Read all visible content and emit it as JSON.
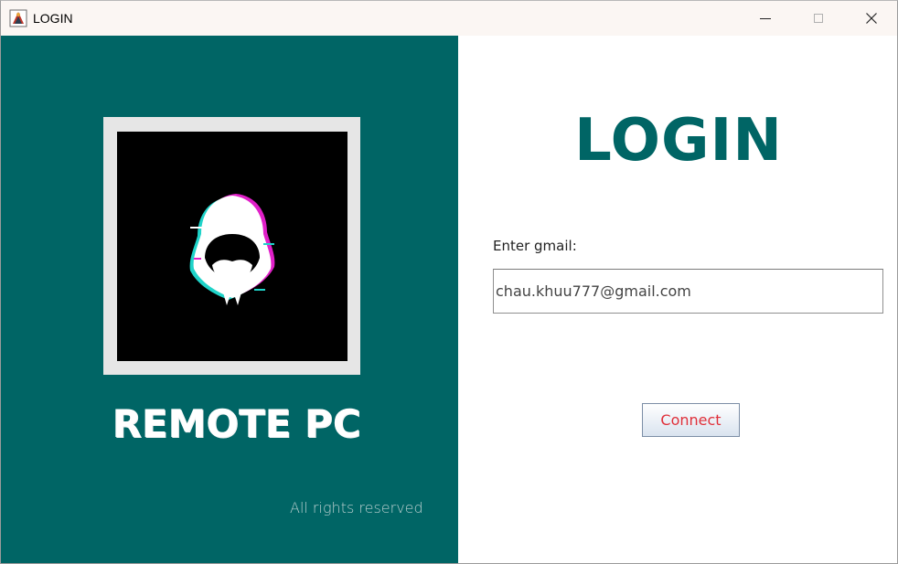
{
  "window": {
    "title": "LOGIN",
    "icon": "java-app-icon",
    "controls": {
      "minimize": "minimize-icon",
      "maximize": "maximize-icon",
      "close": "close-icon"
    }
  },
  "left_panel": {
    "background": "#006565",
    "logo": {
      "icon": "hooded-hacker-logo",
      "frame_color": "#e6e6e6"
    },
    "app_name": "REMOTE PC",
    "footer": "All rights reserved"
  },
  "right_panel": {
    "title": "LOGIN",
    "title_color": "#006565",
    "gmail_label": "Enter gmail:",
    "gmail_value": "chau.khuu777@gmail.com",
    "connect_label": "Connect",
    "connect_color": "#e0303a"
  }
}
